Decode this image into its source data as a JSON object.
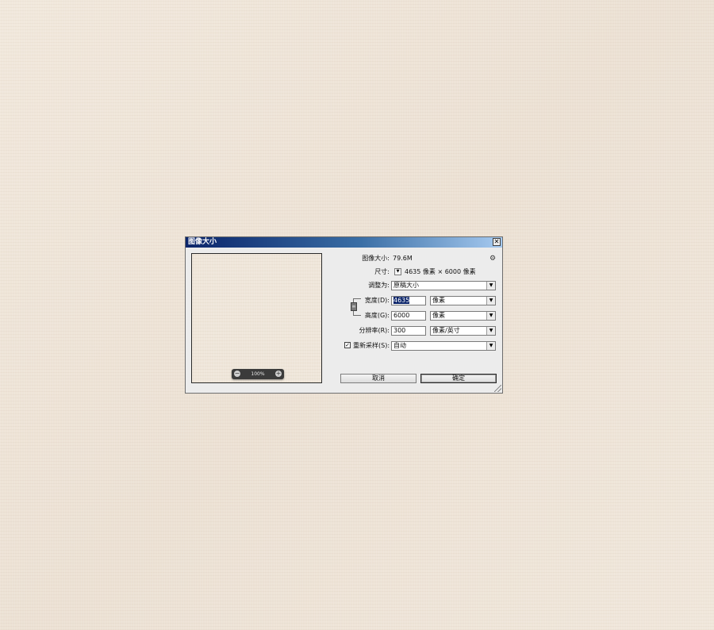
{
  "dialog": {
    "title": "图像大小",
    "close_glyph": "✕"
  },
  "preview": {
    "zoom_level": "100%",
    "zoom_out_glyph": "−",
    "zoom_in_glyph": "+"
  },
  "info": {
    "image_size_label": "图像大小:",
    "image_size_value": "79.6M",
    "dimensions_label": "尺寸:",
    "dimensions_value": "4635 像素  ×  6000 像素"
  },
  "fit_to": {
    "label": "调整为:",
    "value": "原稿大小"
  },
  "width": {
    "label": "宽度(D):",
    "value": "4635",
    "unit": "像素"
  },
  "height": {
    "label": "高度(G):",
    "value": "6000",
    "unit": "像素"
  },
  "resolution": {
    "label": "分辨率(R):",
    "value": "300",
    "unit": "像素/英寸"
  },
  "resample": {
    "label": "重新采样(S):",
    "checked": true,
    "check_glyph": "✓",
    "value": "自动"
  },
  "buttons": {
    "cancel": "取消",
    "ok": "确定"
  },
  "icons": {
    "gear": "gear-icon",
    "link": "link-chain-icon",
    "dropdown_arrow": "▼"
  }
}
